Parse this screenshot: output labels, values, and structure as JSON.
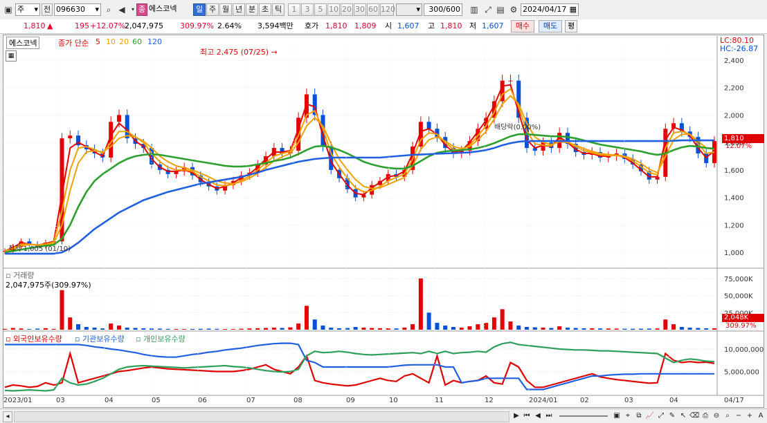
{
  "toolbar": {
    "market": "주",
    "prev_label": "전",
    "stock_code": "096630",
    "stock_badge": "종",
    "stock_name": "에스코넥",
    "periods": [
      "일",
      "주",
      "월",
      "년",
      "분",
      "초",
      "틱"
    ],
    "minutes": [
      "1",
      "3",
      "5",
      "10",
      "20",
      "30",
      "60",
      "120"
    ],
    "count_value": "300",
    "count_total": "/600",
    "date": "2024/04/17"
  },
  "quote": {
    "price": "1,810",
    "change": "195",
    "change_pct": "+12.07%",
    "volume": "2,047,975",
    "volume_pct": "309.97%",
    "turnover": "2.64%",
    "amount": "3,594백만",
    "hoga_label": "호가",
    "ask": "1,810",
    "bid": "1,809",
    "open_label": "시",
    "open": "1,607",
    "high_label": "고",
    "high": "1,810",
    "low_label": "저",
    "low": "1,607",
    "buy_label": "매수",
    "sell_label": "매도",
    "avg_label": "평"
  },
  "price_panel": {
    "stock_tag": "에스코넥",
    "ma_label": "종가 단순",
    "ma_periods": [
      "5",
      "10",
      "20",
      "60",
      "120"
    ],
    "ma_colors": [
      "#e60000",
      "#f0a000",
      "#f0a000",
      "#2ca02c",
      "#1f5fe0"
    ],
    "lc": "LC:80.10",
    "hc": "HC:-26.87",
    "high_note": "최고 2,475 (07/25)",
    "low_note": "최저 1,005 (01/10)",
    "dividend_note": "배당락(0.00%)",
    "last_price": "1,810",
    "last_pct": "12.07%"
  },
  "volume_panel": {
    "title": "거래량",
    "info": "2,047,975주(309.97%)",
    "last_volume": "2,048K",
    "last_pct": "309.97%"
  },
  "holding_panel": {
    "legend": [
      "외국인보유수량",
      "기관보유수량",
      "개인보유수량"
    ],
    "colors": [
      "#e00000",
      "#1f5fe0",
      "#2e9e5b"
    ]
  },
  "x_axis": {
    "labels": [
      "2023/01",
      "03",
      "04",
      "05",
      "06",
      "07",
      "08",
      "09",
      "10",
      "11",
      "12",
      "2024/01",
      "02",
      "03",
      "04",
      "04/17"
    ]
  },
  "chart_data": [
    {
      "type": "candlestick",
      "title": "에스코넥",
      "y_ticks": [
        1000,
        1200,
        1400,
        1600,
        1800,
        2000,
        2200,
        2400
      ],
      "ylim": [
        900,
        2500
      ],
      "x_range": [
        "2023/01",
        "2024/04/17"
      ],
      "series": [
        {
          "name": "close",
          "values": [
            1010,
            1040,
            1080,
            1060,
            1050,
            1070,
            1080,
            1830,
            1850,
            1780,
            1750,
            1720,
            1690,
            1950,
            2000,
            1830,
            1790,
            1760,
            1640,
            1600,
            1570,
            1590,
            1620,
            1560,
            1510,
            1480,
            1450,
            1490,
            1520,
            1560,
            1580,
            1640,
            1700,
            1760,
            1720,
            1740,
            1980,
            2150,
            2000,
            1770,
            1600,
            1540,
            1460,
            1400,
            1420,
            1490,
            1520,
            1570,
            1550,
            1600,
            1770,
            1950,
            1900,
            1840,
            1760,
            1720,
            1740,
            1810,
            1900,
            1980,
            2100,
            2250,
            2250,
            1980,
            1760,
            1740,
            1800,
            1760,
            1870,
            1790,
            1730,
            1710,
            1730,
            1690,
            1700,
            1720,
            1680,
            1640,
            1590,
            1530,
            1550,
            1900,
            1940,
            1880,
            1840,
            1720,
            1650,
            1810
          ]
        },
        {
          "name": "5",
          "values": [
            1010,
            1035,
            1070,
            1060,
            1052,
            1065,
            1080,
            1420,
            1760,
            1800,
            1770,
            1730,
            1700,
            1850,
            1940,
            1890,
            1810,
            1770,
            1680,
            1620,
            1590,
            1590,
            1600,
            1580,
            1530,
            1495,
            1465,
            1480,
            1505,
            1545,
            1570,
            1620,
            1680,
            1730,
            1730,
            1740,
            1900,
            2080,
            2060,
            1850,
            1660,
            1570,
            1490,
            1430,
            1420,
            1470,
            1510,
            1550,
            1560,
            1590,
            1720,
            1880,
            1900,
            1860,
            1780,
            1730,
            1740,
            1800,
            1880,
            1960,
            2070,
            2210,
            2220,
            2020,
            1820,
            1760,
            1780,
            1770,
            1840,
            1800,
            1750,
            1720,
            1720,
            1700,
            1700,
            1710,
            1690,
            1650,
            1600,
            1550,
            1550,
            1820,
            1910,
            1890,
            1850,
            1760,
            1690,
            1740
          ]
        },
        {
          "name": "10",
          "values": [
            1010,
            1030,
            1060,
            1060,
            1055,
            1060,
            1075,
            1300,
            1600,
            1760,
            1770,
            1750,
            1720,
            1800,
            1880,
            1880,
            1840,
            1800,
            1720,
            1660,
            1620,
            1600,
            1600,
            1590,
            1550,
            1520,
            1490,
            1485,
            1495,
            1525,
            1555,
            1600,
            1650,
            1700,
            1720,
            1735,
            1850,
            2000,
            2030,
            1900,
            1720,
            1620,
            1540,
            1470,
            1440,
            1450,
            1480,
            1520,
            1545,
            1570,
            1680,
            1820,
            1870,
            1860,
            1800,
            1750,
            1745,
            1780,
            1850,
            1920,
            2020,
            2150,
            2190,
            2060,
            1880,
            1790,
            1780,
            1775,
            1820,
            1805,
            1770,
            1740,
            1725,
            1710,
            1705,
            1705,
            1695,
            1665,
            1625,
            1580,
            1565,
            1760,
            1870,
            1880,
            1860,
            1790,
            1720,
            1730
          ]
        },
        {
          "name": "20",
          "values": [
            1010,
            1025,
            1050,
            1055,
            1055,
            1058,
            1068,
            1200,
            1450,
            1650,
            1730,
            1740,
            1730,
            1770,
            1830,
            1850,
            1840,
            1810,
            1760,
            1700,
            1660,
            1630,
            1615,
            1600,
            1575,
            1550,
            1520,
            1505,
            1500,
            1515,
            1540,
            1575,
            1620,
            1665,
            1695,
            1720,
            1800,
            1920,
            1980,
            1920,
            1790,
            1680,
            1600,
            1530,
            1480,
            1465,
            1470,
            1495,
            1520,
            1545,
            1630,
            1750,
            1820,
            1840,
            1810,
            1770,
            1755,
            1770,
            1820,
            1880,
            1970,
            2080,
            2140,
            2080,
            1940,
            1840,
            1800,
            1785,
            1805,
            1800,
            1780,
            1755,
            1735,
            1720,
            1712,
            1708,
            1700,
            1680,
            1648,
            1605,
            1580,
            1700,
            1820,
            1860,
            1860,
            1810,
            1760,
            1750
          ]
        },
        {
          "name": "60",
          "values": [
            1000,
            1010,
            1020,
            1030,
            1040,
            1048,
            1055,
            1100,
            1200,
            1330,
            1440,
            1520,
            1570,
            1610,
            1650,
            1680,
            1700,
            1710,
            1715,
            1710,
            1700,
            1690,
            1680,
            1670,
            1660,
            1650,
            1640,
            1630,
            1625,
            1625,
            1630,
            1640,
            1650,
            1665,
            1675,
            1690,
            1715,
            1745,
            1770,
            1775,
            1765,
            1745,
            1720,
            1690,
            1660,
            1640,
            1625,
            1615,
            1610,
            1610,
            1630,
            1665,
            1700,
            1725,
            1735,
            1740,
            1745,
            1750,
            1760,
            1775,
            1795,
            1820,
            1845,
            1860,
            1860,
            1855,
            1850,
            1845,
            1845,
            1840,
            1830,
            1815,
            1800,
            1785,
            1775,
            1765,
            1755,
            1745,
            1735,
            1720,
            1710,
            1720,
            1745,
            1765,
            1775,
            1770,
            1760,
            1755
          ]
        },
        {
          "name": "120",
          "values": [
            990,
            990,
            990,
            990,
            990,
            990,
            990,
            1000,
            1030,
            1070,
            1120,
            1170,
            1210,
            1250,
            1290,
            1320,
            1350,
            1380,
            1400,
            1420,
            1440,
            1455,
            1470,
            1485,
            1500,
            1510,
            1520,
            1530,
            1540,
            1550,
            1565,
            1580,
            1600,
            1615,
            1630,
            1645,
            1660,
            1670,
            1680,
            1685,
            1690,
            1690,
            1690,
            1690,
            1690,
            1690,
            1690,
            1695,
            1700,
            1705,
            1710,
            1712,
            1715,
            1718,
            1720,
            1722,
            1725,
            1728,
            1735,
            1745,
            1760,
            1780,
            1795,
            1805,
            1810,
            1810,
            1810,
            1810,
            1810,
            1810,
            1810,
            1810,
            1810,
            1810,
            1810,
            1810,
            1810,
            1810,
            1810,
            1810,
            1810,
            1810,
            1812,
            1815,
            1815,
            1815,
            1815,
            1815
          ]
        }
      ]
    },
    {
      "type": "bar",
      "title": "거래량",
      "y_ticks": [
        "25,000K",
        "50,000K",
        "75,000K"
      ],
      "ylim": [
        0,
        80000
      ],
      "values_k": [
        1200,
        2500,
        1800,
        900,
        1500,
        2200,
        1100,
        58000,
        18000,
        8000,
        4000,
        3000,
        2000,
        9000,
        6000,
        3000,
        2500,
        2000,
        1800,
        1500,
        1200,
        1000,
        900,
        1100,
        1300,
        1500,
        1200,
        1000,
        900,
        1400,
        1800,
        2200,
        2500,
        3000,
        2600,
        3500,
        9000,
        35000,
        15000,
        6000,
        3000,
        2000,
        2500,
        4000,
        3000,
        2500,
        2200,
        2000,
        1800,
        3000,
        8000,
        75000,
        25000,
        10000,
        6000,
        4000,
        3000,
        5000,
        8000,
        10000,
        18000,
        30000,
        12000,
        6000,
        4000,
        3500,
        3000,
        2500,
        5000,
        3000,
        2500,
        2000,
        2000,
        1800,
        1700,
        1600,
        1500,
        1400,
        1400,
        1600,
        1800,
        15000,
        8000,
        4000,
        3000,
        2500,
        2000,
        2048
      ]
    },
    {
      "type": "line",
      "title": "보유수량",
      "y_ticks": [
        "5,000,000",
        "10,000,000"
      ],
      "ylim": [
        0,
        12000000
      ],
      "series": [
        {
          "name": "외국인보유수량",
          "values": [
            1500000,
            2000000,
            1800000,
            1500000,
            1700000,
            2500000,
            2000000,
            2500000,
            9000000,
            2500000,
            3000000,
            3500000,
            4000000,
            4500000,
            5000000,
            5200000,
            5500000,
            5800000,
            6000000,
            5800000,
            5600000,
            5500000,
            5400000,
            5300000,
            5200000,
            5100000,
            5000000,
            5000000,
            5000000,
            5200000,
            5500000,
            6000000,
            6500000,
            5500000,
            5000000,
            4500000,
            6000000,
            8500000,
            3000000,
            2500000,
            2200000,
            2000000,
            1800000,
            2000000,
            2500000,
            3000000,
            3500000,
            3000000,
            2800000,
            4000000,
            4500000,
            3500000,
            2500000,
            8500000,
            2000000,
            3000000,
            2500000,
            2800000,
            3000000,
            4000000,
            2500000,
            2200000,
            7000000,
            6000000,
            3000000,
            1500000,
            1500000,
            2000000,
            2500000,
            3000000,
            3500000,
            4000000,
            4500000,
            3800000,
            3500000,
            3200000,
            3000000,
            2800000,
            2600000,
            2400000,
            2500000,
            9000000,
            7500000,
            7000000,
            7200000,
            7000000,
            7100000,
            6800000
          ]
        },
        {
          "name": "기관보유수량",
          "values": [
            11000000,
            11000000,
            11000000,
            11000000,
            11000000,
            11000000,
            11000000,
            11000000,
            11000000,
            11000000,
            10800000,
            10500000,
            10300000,
            10000000,
            9800000,
            9500000,
            9200000,
            8800000,
            8500000,
            8300000,
            8200000,
            8200000,
            8500000,
            8800000,
            9000000,
            9300000,
            9500000,
            9800000,
            10000000,
            10200000,
            10500000,
            10800000,
            11000000,
            11200000,
            11300000,
            11300000,
            11000000,
            7500000,
            7000000,
            6000000,
            6000000,
            6000000,
            6000000,
            6000000,
            6000000,
            6000000,
            6000000,
            6000000,
            6200000,
            6400000,
            6500000,
            6500000,
            6500000,
            6500000,
            6000000,
            6000000,
            2500000,
            2800000,
            3000000,
            3500000,
            3500000,
            3500000,
            3500000,
            3500000,
            1000000,
            1000000,
            1000000,
            1500000,
            2000000,
            2500000,
            3000000,
            3500000,
            4000000,
            4000000,
            4200000,
            4300000,
            4400000,
            4400000,
            4500000,
            4500000,
            4500000,
            4500000,
            4500000,
            4500000,
            4500000,
            4500000,
            4500000,
            4500000
          ]
        },
        {
          "name": "개인보유수량",
          "values": [
            800000,
            700000,
            800000,
            900000,
            800000,
            700000,
            900000,
            3500000,
            2500000,
            2000000,
            2200000,
            2800000,
            3500000,
            4500000,
            5500000,
            6000000,
            6200000,
            6300000,
            6200000,
            6100000,
            6000000,
            5900000,
            5800000,
            5900000,
            6000000,
            6100000,
            6200000,
            6300000,
            6100000,
            6000000,
            5800000,
            5500000,
            5200000,
            5000000,
            4900000,
            5000000,
            5500000,
            8500000,
            9500000,
            9200000,
            9300000,
            9500000,
            9300000,
            9000000,
            8800000,
            8700000,
            8800000,
            8900000,
            9000000,
            9100000,
            9200000,
            9000000,
            9500000,
            9000000,
            9500000,
            9000000,
            9200000,
            9300000,
            9500000,
            9300000,
            10500000,
            11200000,
            11500000,
            11000000,
            10800000,
            10600000,
            10400000,
            10200000,
            10000000,
            9900000,
            9800000,
            9800000,
            9700000,
            9600000,
            9600000,
            9500000,
            9400000,
            9300000,
            9200000,
            9100000,
            9000000,
            8000000,
            7000000,
            7500000,
            7800000,
            7600000,
            7300000,
            7200000
          ]
        }
      ]
    }
  ]
}
